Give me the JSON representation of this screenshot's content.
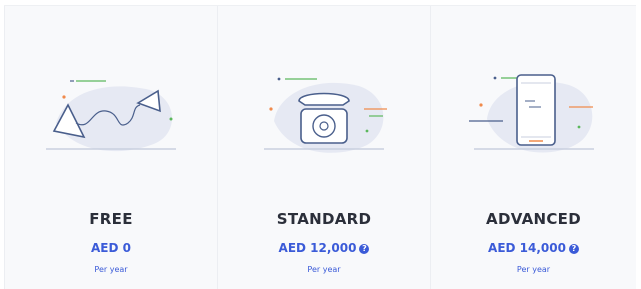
{
  "plans": [
    {
      "name": "FREE",
      "price": "AED 0",
      "period": "Per year",
      "has_info": false,
      "illustration": "string-telephone-illustration"
    },
    {
      "name": "STANDARD",
      "price": "AED 12,000",
      "period": "Per year",
      "has_info": true,
      "illustration": "rotary-phone-illustration"
    },
    {
      "name": "ADVANCED",
      "price": "AED 14,000",
      "period": "Per year",
      "has_info": true,
      "illustration": "smartphone-illustration"
    }
  ],
  "colors": {
    "accent": "#3b5bd8",
    "title": "#2b2f3a",
    "card_bg": "#f8f9fb",
    "illus_stroke": "#4a5f8c",
    "illus_blob": "#e6e9f3"
  }
}
